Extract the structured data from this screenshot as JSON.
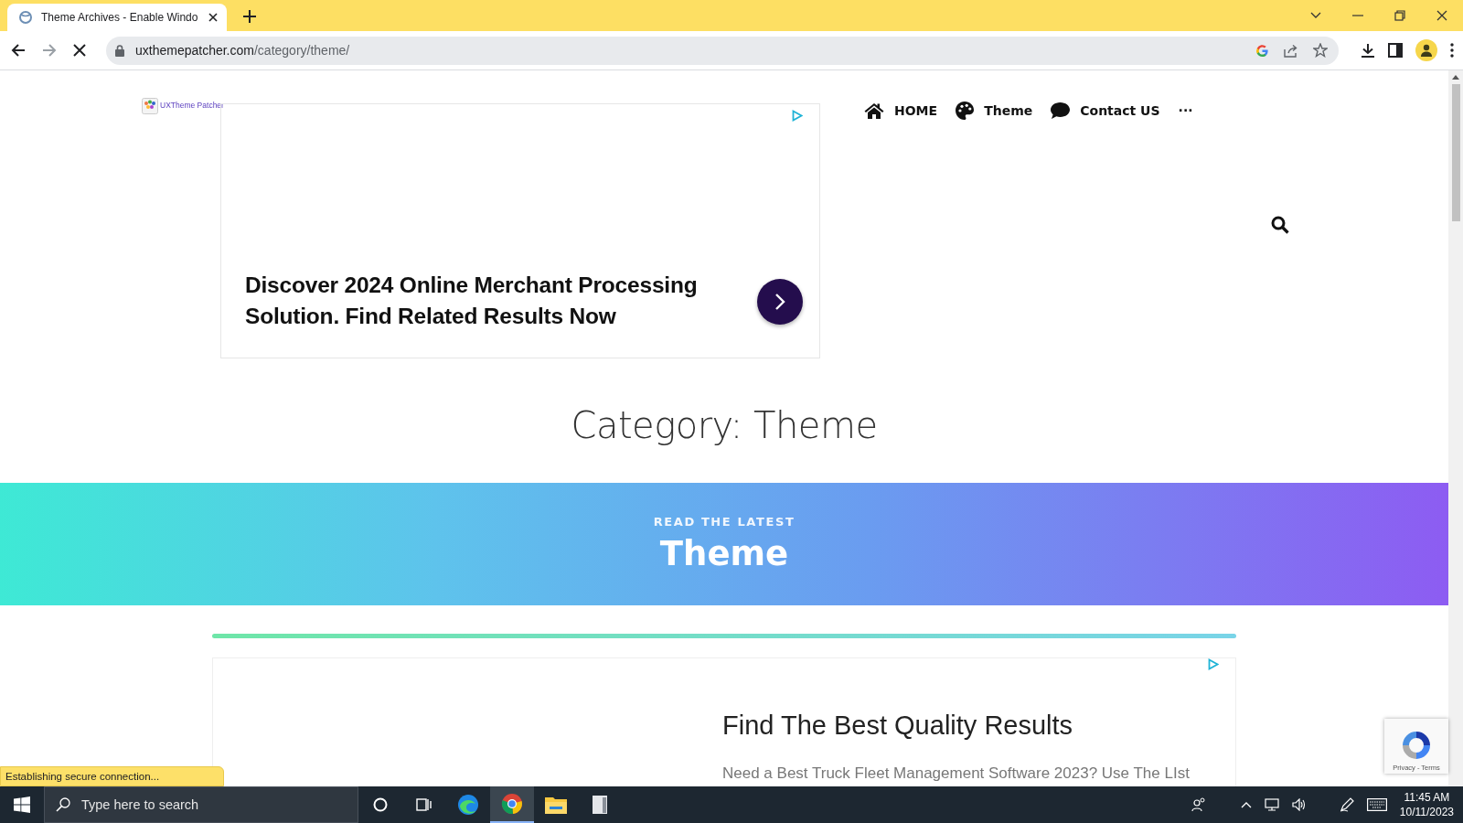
{
  "browser": {
    "tab_title": "Theme Archives - Enable Windo",
    "url_host": "uxthemepatcher.com",
    "url_path": "/category/theme/",
    "status": "Establishing secure connection..."
  },
  "site": {
    "logo_text": "UXTheme Patcher",
    "nav": [
      {
        "label": "HOME",
        "kind": "home"
      },
      {
        "label": "Theme",
        "kind": "palette"
      },
      {
        "label": "Contact US",
        "kind": "chat"
      },
      {
        "label": "···",
        "kind": "more"
      }
    ]
  },
  "ad": {
    "headline": "Discover 2024 Online Merchant Processing Solution. Find Related Results Now"
  },
  "category_heading": "Category: Theme",
  "banner": {
    "kicker": "READ THE LATEST",
    "title": "Theme"
  },
  "ad2": {
    "headline": "Find The Best Quality Results",
    "text": "Need a Best Truck Fleet Management Software 2023? Use The LIst"
  },
  "recaptcha": {
    "links": "Privacy - Terms"
  },
  "taskbar": {
    "search_placeholder": "Type here to search",
    "time": "11:45 AM",
    "date": "10/11/2023"
  }
}
